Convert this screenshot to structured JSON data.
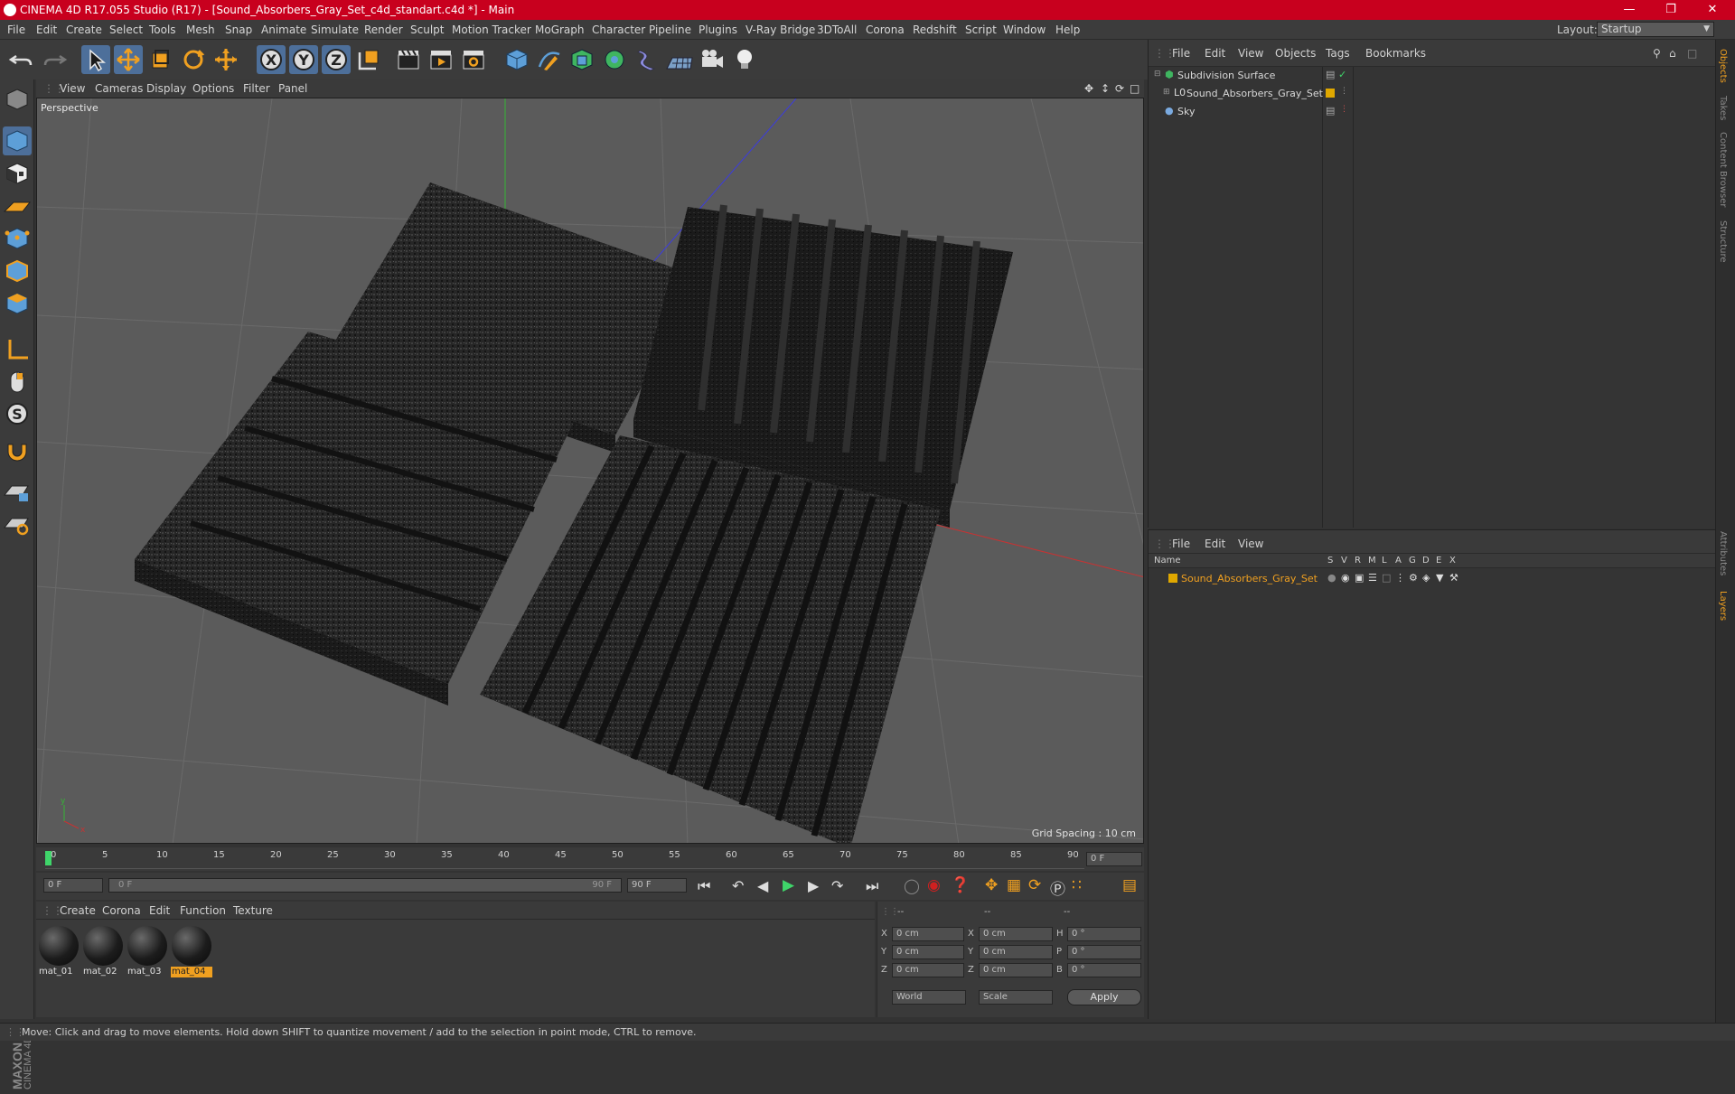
{
  "app": {
    "title": "CINEMA 4D R17.055 Studio (R17) - [Sound_Absorbers_Gray_Set_c4d_standart.c4d *] - Main"
  },
  "menu": {
    "items": [
      "File",
      "Edit",
      "Create",
      "Select",
      "Tools",
      "Mesh",
      "Snap",
      "Animate",
      "Simulate",
      "Render",
      "Sculpt",
      "Motion Tracker",
      "MoGraph",
      "Character",
      "Pipeline",
      "Plugins",
      "V-Ray Bridge",
      "3DToAll",
      "Corona",
      "Redshift",
      "Script",
      "Window",
      "Help"
    ],
    "layout_label": "Layout:",
    "layout_value": "Startup"
  },
  "viewport": {
    "menu": [
      "View",
      "Cameras",
      "Display",
      "Options",
      "Filter",
      "Panel"
    ],
    "label": "Perspective",
    "grid_spacing": "Grid Spacing : 10 cm"
  },
  "timeline": {
    "ticks": [
      "0",
      "5",
      "10",
      "15",
      "20",
      "25",
      "30",
      "35",
      "40",
      "45",
      "50",
      "55",
      "60",
      "65",
      "70",
      "75",
      "80",
      "85",
      "90"
    ],
    "current_frame": "0 F",
    "start_field": "0 F",
    "range_start": "0 F",
    "range_end": "90 F",
    "end_field": "90 F"
  },
  "materials": {
    "menu": [
      "Create",
      "Corona",
      "Edit",
      "Function",
      "Texture"
    ],
    "items": [
      "mat_01",
      "mat_02",
      "mat_03",
      "mat_04"
    ],
    "selected_index": 3
  },
  "coords": {
    "header": [
      "--",
      "--",
      "--"
    ],
    "rows": [
      {
        "a": "X",
        "av": "0 cm",
        "b": "X",
        "bv": "0 cm",
        "c": "H",
        "cv": "0 °"
      },
      {
        "a": "Y",
        "av": "0 cm",
        "b": "Y",
        "bv": "0 cm",
        "c": "P",
        "cv": "0 °"
      },
      {
        "a": "Z",
        "av": "0 cm",
        "b": "Z",
        "bv": "0 cm",
        "c": "B",
        "cv": "0 °"
      }
    ],
    "world": "World",
    "scale": "Scale",
    "apply": "Apply"
  },
  "objects": {
    "menu": [
      "File",
      "Edit",
      "View",
      "Objects",
      "Tags",
      "Bookmarks"
    ],
    "items": [
      "Subdivision Surface",
      "Sound_Absorbers_Gray_Set",
      "Sky"
    ]
  },
  "layers": {
    "menu": [
      "File",
      "Edit",
      "View"
    ],
    "columns": [
      "Name",
      "S",
      "V",
      "R",
      "M",
      "L",
      "A",
      "G",
      "D",
      "E",
      "X"
    ],
    "row_name": "Sound_Absorbers_Gray_Set"
  },
  "side_tabs": [
    "Objects",
    "Takes",
    "Content Browser",
    "Structure",
    "Attributes",
    "Layers"
  ],
  "status": "Move: Click and drag to move elements. Hold down SHIFT to quantize movement / add to the selection in point mode, CTRL to remove.",
  "brand": "MAXON CINEMA 4D",
  "colors": {
    "accent": "#f0a020",
    "title_bar": "#c8001e",
    "viewport_bg": "#5b5b5b",
    "selected_blue": "#3d6fb0"
  }
}
